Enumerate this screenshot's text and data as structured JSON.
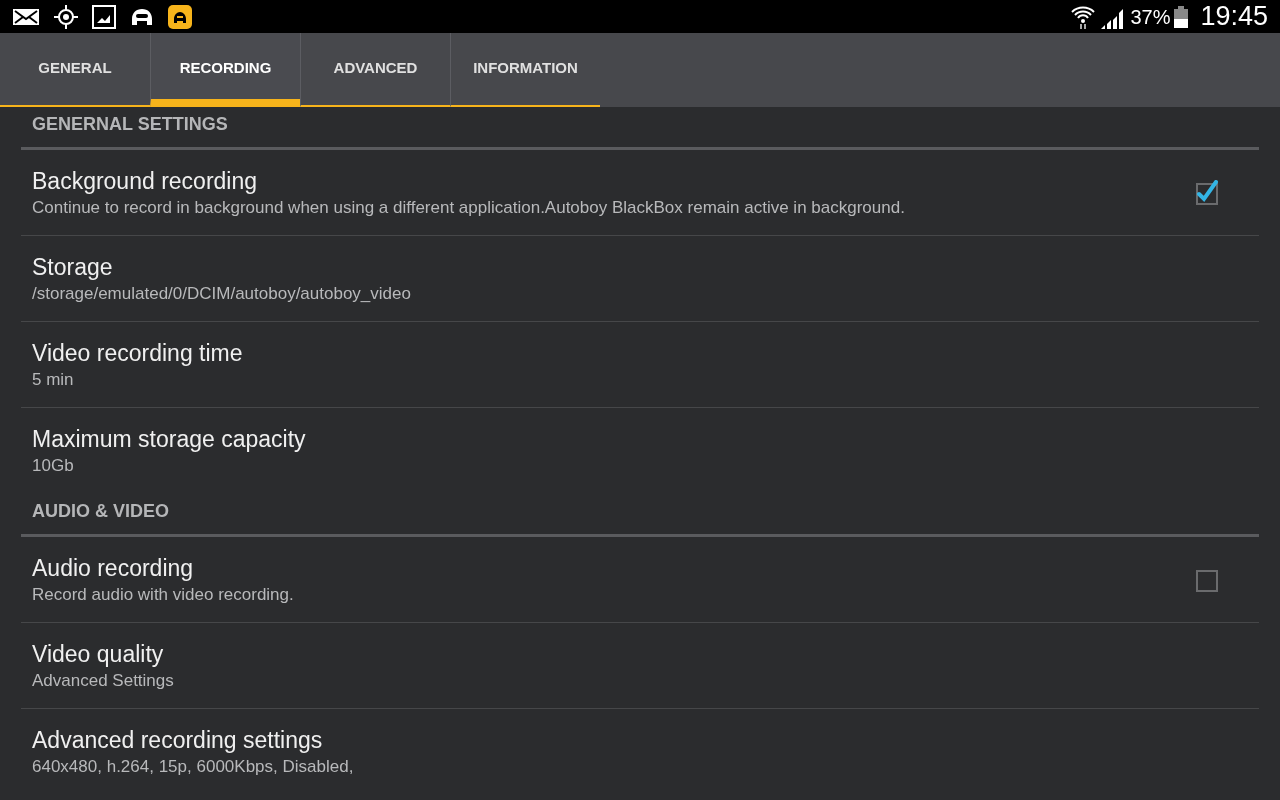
{
  "status_bar": {
    "battery_percent": "37%",
    "time": "19:45"
  },
  "tabs": [
    {
      "label": "GENERAL",
      "selected": false
    },
    {
      "label": "RECORDING",
      "selected": true
    },
    {
      "label": "ADVANCED",
      "selected": false
    },
    {
      "label": "INFORMATION",
      "selected": false
    }
  ],
  "sections": [
    {
      "title": "GENERNAL SETTINGS",
      "items": [
        {
          "kind": "checkbox",
          "title": "Background recording",
          "summary": "Continue to record in background when using a different application.Autoboy BlackBox remain active in background.",
          "checked": true
        },
        {
          "kind": "plain",
          "title": "Storage",
          "summary": "/storage/emulated/0/DCIM/autoboy/autoboy_video"
        },
        {
          "kind": "plain",
          "title": "Video recording time",
          "summary": "5 min"
        },
        {
          "kind": "plain",
          "title": "Maximum storage capacity",
          "summary": "10Gb"
        }
      ]
    },
    {
      "title": "AUDIO & VIDEO",
      "items": [
        {
          "kind": "checkbox",
          "title": "Audio recording",
          "summary": "Record audio with video recording.",
          "checked": false
        },
        {
          "kind": "plain",
          "title": "Video quality",
          "summary": "Advanced Settings"
        },
        {
          "kind": "plain",
          "title": "Advanced recording settings",
          "summary": "640x480, h.264, 15p, 6000Kbps, Disabled,"
        }
      ]
    }
  ]
}
